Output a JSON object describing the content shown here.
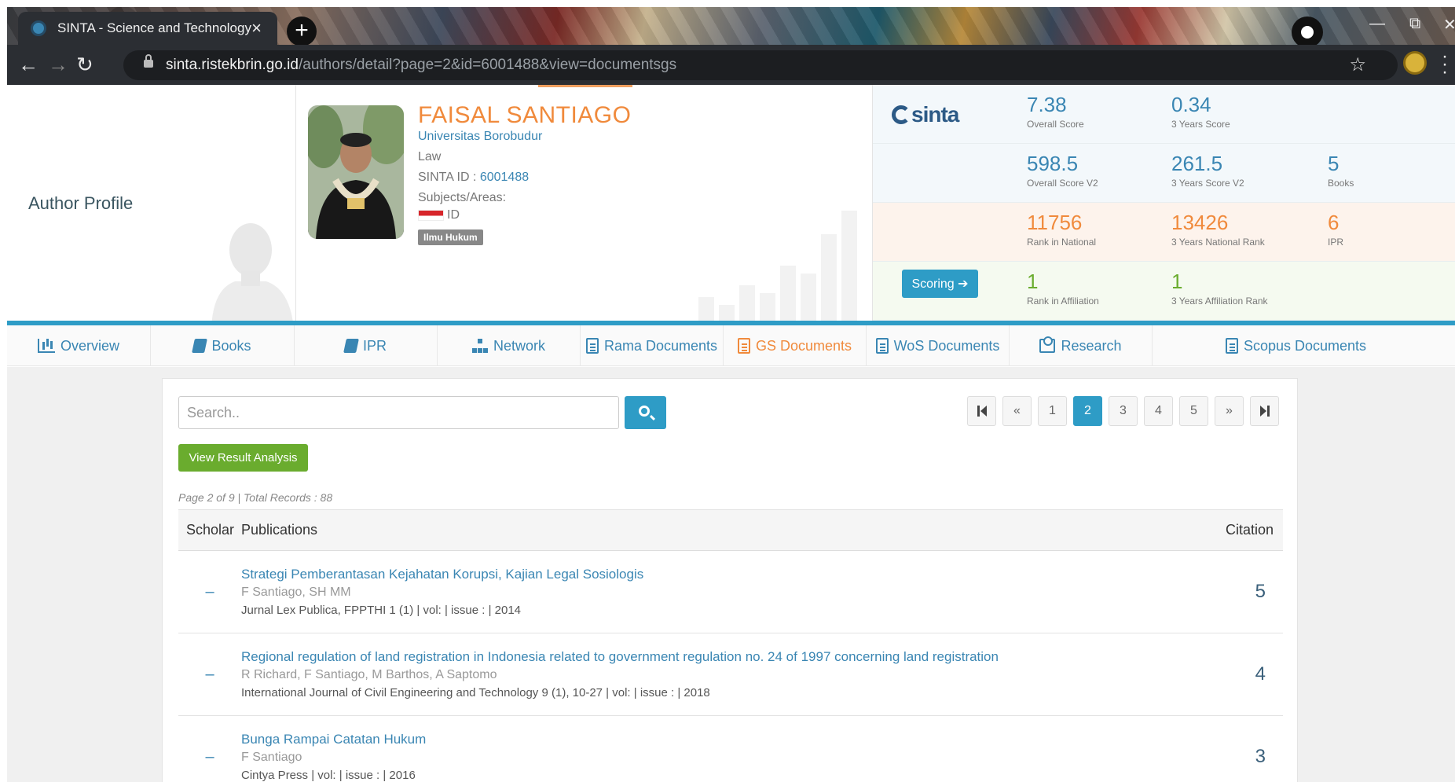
{
  "browser": {
    "tab_title": "SINTA - Science and Technology",
    "tab_close": "×",
    "new_tab": "+",
    "url_host": "sinta.ristekbrin.go.id",
    "url_path": "/authors/detail?page=2&id=6001488&view=documentsgs",
    "back": "←",
    "forward": "→",
    "reload": "↻",
    "star": "☆",
    "minimize": "—",
    "restore": "⧉",
    "close": "✕"
  },
  "profile": {
    "section_label": "Author Profile",
    "name": "FAISAL SANTIAGO",
    "affiliation": "Universitas Borobudur",
    "field": "Law",
    "sinta_id_label": "SINTA ID : ",
    "sinta_id_value": "6001488",
    "subjects_label": "Subjects/Areas:",
    "country": "ID",
    "subject_badge": "Ilmu Hukum"
  },
  "stats": {
    "logo": "sinta",
    "overall_score": {
      "value": "7.38",
      "label": "Overall Score"
    },
    "three_years_score": {
      "value": "0.34",
      "label": "3 Years Score"
    },
    "overall_score_v2": {
      "value": "598.5",
      "label": "Overall Score V2"
    },
    "three_years_score_v2": {
      "value": "261.5",
      "label": "3 Years Score V2"
    },
    "books": {
      "value": "5",
      "label": "Books"
    },
    "rank_national": {
      "value": "11756",
      "label": "Rank in National"
    },
    "three_years_national_rank": {
      "value": "13426",
      "label": "3 Years National Rank"
    },
    "ipr": {
      "value": "6",
      "label": "IPR"
    },
    "rank_affiliation": {
      "value": "1",
      "label": "Rank in Affiliation"
    },
    "three_years_affiliation_rank": {
      "value": "1",
      "label": "3 Years Affiliation Rank"
    },
    "scoring_button": "Scoring ➔"
  },
  "tabs": [
    {
      "label": "Overview",
      "icon": "chart-icon"
    },
    {
      "label": "Books",
      "icon": "book-icon"
    },
    {
      "label": "IPR",
      "icon": "book-icon"
    },
    {
      "label": "Network",
      "icon": "sitemap-icon"
    },
    {
      "label": "Rama Documents",
      "icon": "document-icon"
    },
    {
      "label": "GS Documents",
      "icon": "document-icon",
      "active": true
    },
    {
      "label": "WoS Documents",
      "icon": "document-icon"
    },
    {
      "label": "Research",
      "icon": "research-icon"
    },
    {
      "label": "Scopus Documents",
      "icon": "document-icon"
    }
  ],
  "search": {
    "placeholder": "Search.."
  },
  "view_result_button": "View Result Analysis",
  "pagination": {
    "pages": [
      "1",
      "2",
      "3",
      "4",
      "5"
    ],
    "current": "2",
    "prev": "«",
    "next": "»"
  },
  "page_info": "Page 2 of 9 | Total Records : 88",
  "table": {
    "headers": {
      "scholar": "Scholar",
      "publications": "Publications",
      "citation": "Citation"
    },
    "rows": [
      {
        "scholar": "–",
        "title": "Strategi Pemberantasan Kejahatan Korupsi, Kajian Legal Sosiologis",
        "authors": "F Santiago, SH MM",
        "venue": "Jurnal Lex Publica, FPPTHI 1 (1) | vol: | issue : | 2014",
        "citation": "5"
      },
      {
        "scholar": "–",
        "title": "Regional regulation of land registration in Indonesia related to government regulation no. 24 of 1997 concerning land registration",
        "authors": "R Richard, F Santiago, M Barthos, A Saptomo",
        "venue": "International Journal of Civil Engineering and Technology 9 (1), 10-27 | vol: | issue : | 2018",
        "citation": "4"
      },
      {
        "scholar": "–",
        "title": "Bunga Rampai Catatan Hukum",
        "authors": "F Santiago",
        "venue": "Cintya Press | vol: | issue : | 2016",
        "citation": "3"
      }
    ]
  },
  "colors": {
    "accent": "#2e9cc6",
    "orange": "#f08a3c",
    "green": "#6aac2e",
    "link": "#3a86b3"
  }
}
